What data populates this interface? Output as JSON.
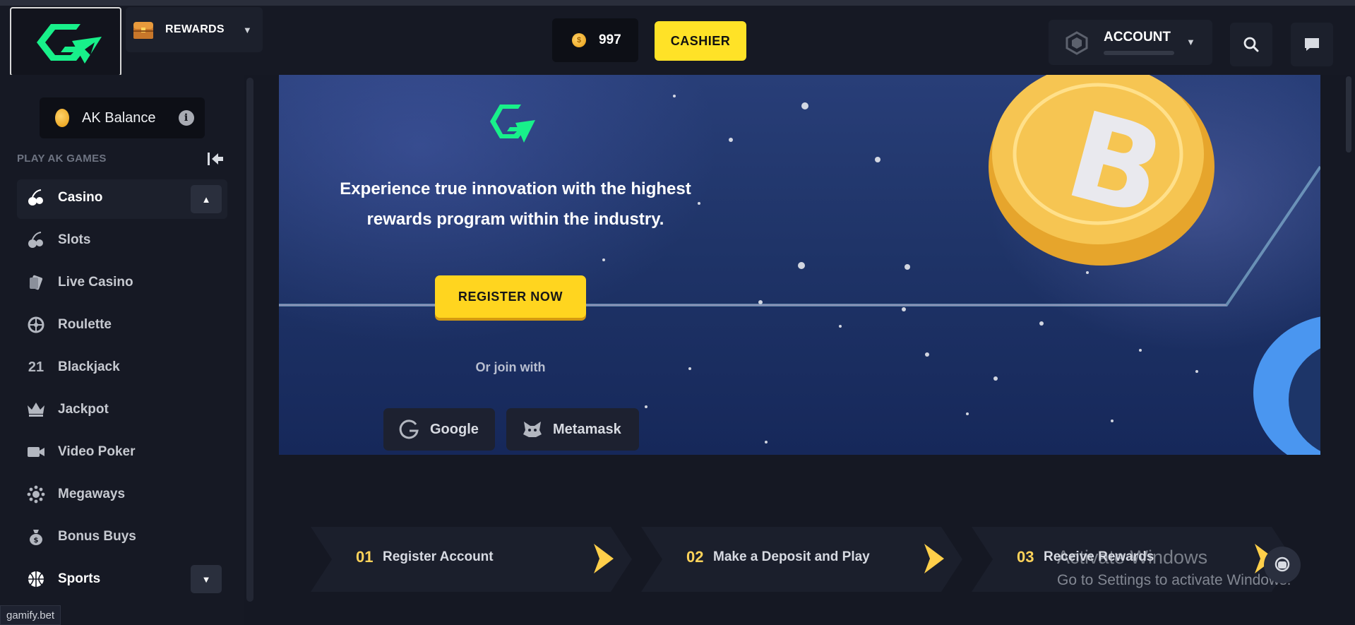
{
  "header": {
    "rewards_label": "REWARDS",
    "balance_value": "997",
    "cashier_label": "CASHIER",
    "account_label": "ACCOUNT"
  },
  "sidebar": {
    "ak_balance_label": "AK Balance",
    "section_label": "PLAY AK GAMES",
    "items": [
      {
        "label": "Casino",
        "icon": "casino-icon"
      },
      {
        "label": "Slots",
        "icon": "cherries-icon"
      },
      {
        "label": "Live Casino",
        "icon": "cards-icon"
      },
      {
        "label": "Roulette",
        "icon": "roulette-icon"
      },
      {
        "label": "Blackjack",
        "icon": "blackjack-21-icon"
      },
      {
        "label": "Jackpot",
        "icon": "crown-icon"
      },
      {
        "label": "Video Poker",
        "icon": "video-camera-icon"
      },
      {
        "label": "Megaways",
        "icon": "megaways-icon"
      },
      {
        "label": "Bonus Buys",
        "icon": "money-bag-icon"
      },
      {
        "label": "Sports",
        "icon": "basketball-icon"
      }
    ],
    "blackjack_glyph": "21"
  },
  "hero": {
    "heading_line1": "Experience true innovation with the highest",
    "heading_line2": "rewards program within the industry.",
    "register_label": "REGISTER NOW",
    "or_join": "Or join with",
    "google_label": "Google",
    "metamask_label": "Metamask"
  },
  "steps": [
    {
      "num": "01",
      "label": "Register Account"
    },
    {
      "num": "02",
      "label": "Make a Deposit and Play"
    },
    {
      "num": "03",
      "label": "Receive Rewards"
    }
  ],
  "status_url": "gamify.bet",
  "watermark": {
    "line1": "Activate Windows",
    "line2": "Go to Settings to activate Windows."
  },
  "colors": {
    "accent_green": "#18f08a",
    "cashier_yellow": "#ffe227",
    "step_number": "#ffd35a"
  }
}
